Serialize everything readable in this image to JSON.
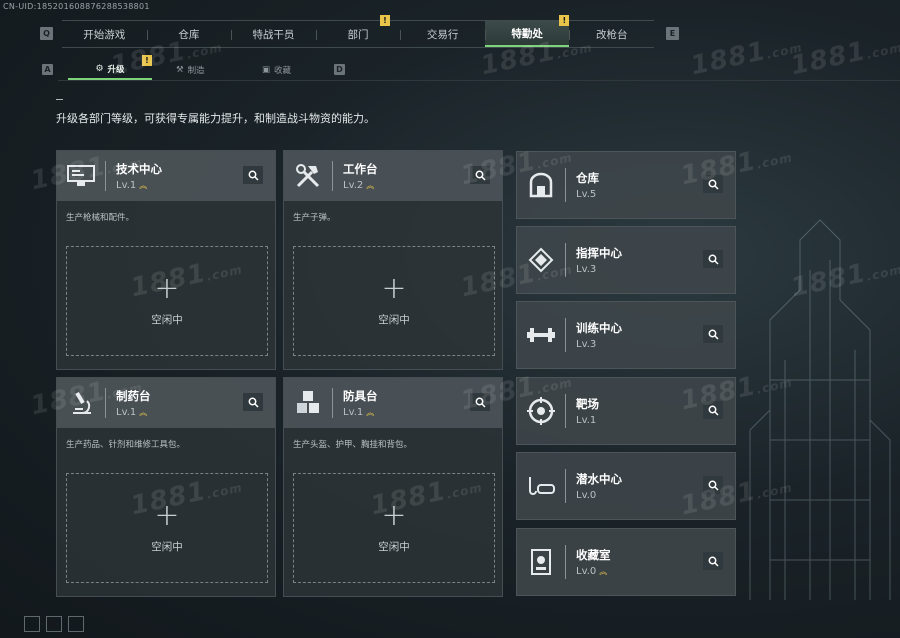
{
  "uid": "CN-UID:18520160887628853880​1",
  "nav": {
    "left_key": "Q",
    "right_key": "E",
    "tabs": [
      {
        "label": "开始游戏",
        "alert": false
      },
      {
        "label": "仓库",
        "alert": false
      },
      {
        "label": "特战干员",
        "alert": false
      },
      {
        "label": "部门",
        "alert": true
      },
      {
        "label": "交易行",
        "alert": false
      },
      {
        "label": "特勤处",
        "alert": true,
        "active": true
      },
      {
        "label": "改枪台",
        "alert": false
      }
    ],
    "alert_mark": "!"
  },
  "subnav": {
    "left_key": "A",
    "right_key": "D",
    "tabs": [
      {
        "label": "升级",
        "active": true,
        "alert": true
      },
      {
        "label": "制造",
        "active": false
      },
      {
        "label": "收藏",
        "active": false
      }
    ]
  },
  "description": "升级各部门等级，可获得专属能力提升，和制造战斗物资的能力。",
  "watermark": "1881",
  "watermark_suffix": ".com",
  "big_cards": [
    {
      "title": "技术中心",
      "level": "Lv.1",
      "desc": "生产枪械和配件。",
      "status": "空闲中",
      "icon": "monitor-icon"
    },
    {
      "title": "工作台",
      "level": "Lv.2",
      "desc": "生产子弹。",
      "status": "空闲中",
      "icon": "tools-icon"
    },
    {
      "title": "制药台",
      "level": "Lv.1",
      "desc": "生产药品、针剂和维修工具包。",
      "status": "空闲中",
      "icon": "microscope-icon"
    },
    {
      "title": "防具台",
      "level": "Lv.1",
      "desc": "生产头盔、护甲、胸挂和背包。",
      "status": "空闲中",
      "icon": "cubes-icon"
    }
  ],
  "small_cards": [
    {
      "title": "仓库",
      "level": "Lv.5",
      "icon": "warehouse-icon",
      "chev": false
    },
    {
      "title": "指挥中心",
      "level": "Lv.3",
      "icon": "command-icon",
      "chev": false
    },
    {
      "title": "训练中心",
      "level": "Lv.3",
      "icon": "dumbbell-icon",
      "chev": false
    },
    {
      "title": "靶场",
      "level": "Lv.1",
      "icon": "target-icon",
      "chev": false
    },
    {
      "title": "潜水中心",
      "level": "Lv.0",
      "icon": "diving-mask-icon",
      "chev": false
    },
    {
      "title": "收藏室",
      "level": "Lv.0",
      "icon": "trophy-case-icon",
      "chev": true
    }
  ],
  "colors": {
    "accent": "#7fd37a",
    "alert": "#e8c44a"
  }
}
